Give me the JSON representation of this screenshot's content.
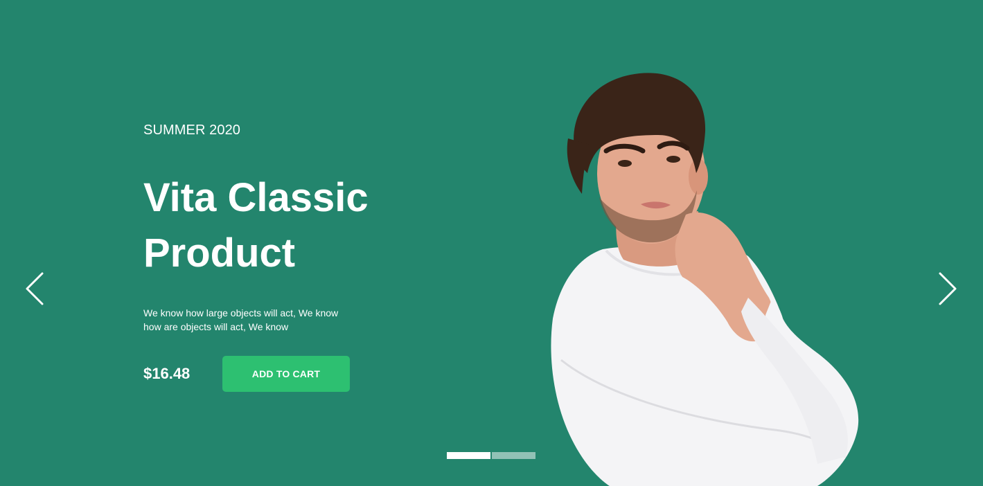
{
  "hero": {
    "season": "SUMMER 2020",
    "title_line1": "Vita Classic",
    "title_line2": "Product",
    "description": "We know how large objects will act, We know how are objects will act, We know",
    "price": "$16.48",
    "cart_label": "ADD TO CART",
    "model_image": "man-in-white-sweater-photo"
  },
  "carousel": {
    "prev_icon": "chevron-left-icon",
    "next_icon": "chevron-right-icon",
    "slides": 2,
    "active_slide": 1
  },
  "colors": {
    "background": "#23856D",
    "button": "#2DC071",
    "text": "#FFFFFF"
  }
}
